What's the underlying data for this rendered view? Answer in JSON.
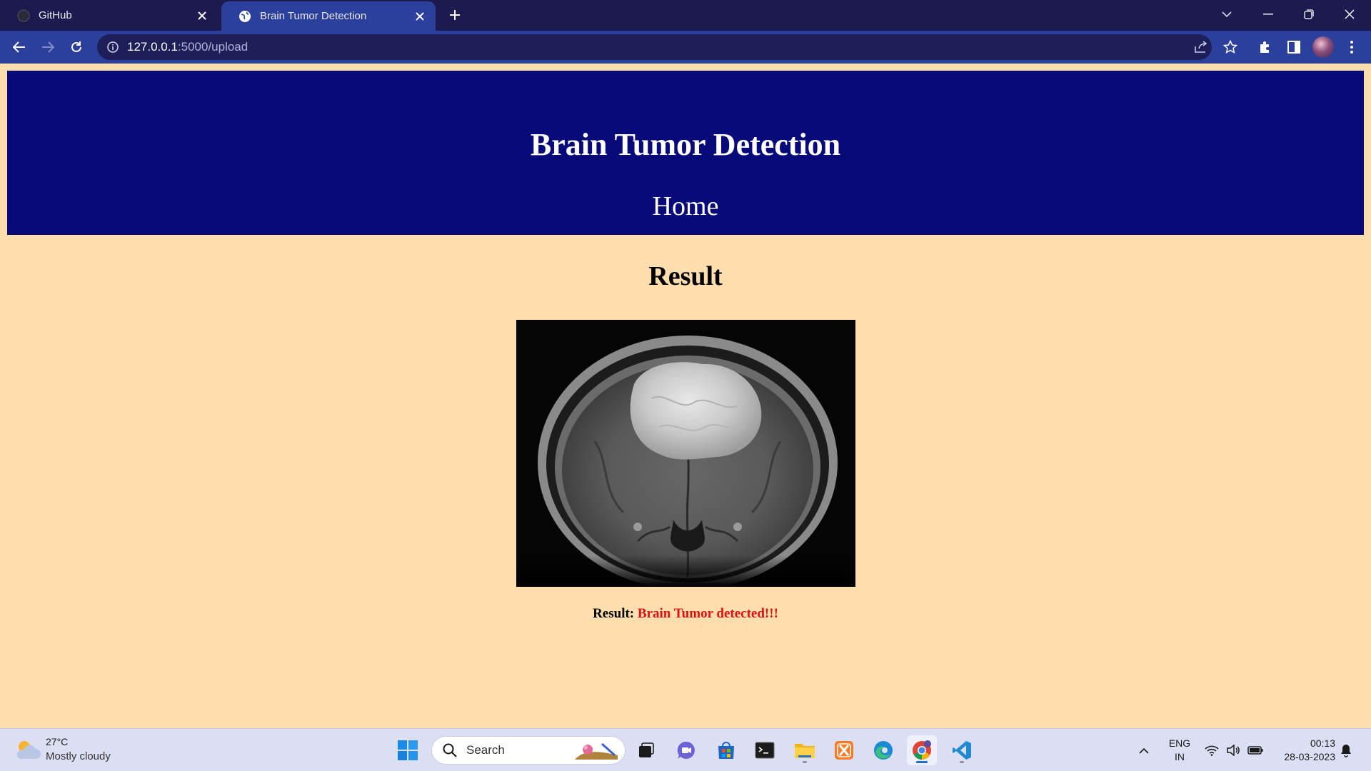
{
  "browser": {
    "tabs": [
      {
        "title": "GitHub",
        "active": false
      },
      {
        "title": "Brain Tumor Detection",
        "active": true
      }
    ],
    "url": {
      "host": "127.0.0.1",
      "path": ":5000/upload"
    }
  },
  "page": {
    "site_title": "Brain Tumor Detection",
    "nav_home": "Home",
    "result_heading": "Result",
    "result_label": "Result:",
    "result_value": "Brain Tumor detected!!!",
    "image_alt": "MRI brain scan",
    "colors": {
      "background": "#ffdead",
      "banner": "#070a78",
      "result_value": "#e01010"
    }
  },
  "taskbar": {
    "weather": {
      "temp": "27°C",
      "desc": "Mostly cloudy"
    },
    "search_placeholder": "Search",
    "apps": [
      "windows-start",
      "task-view",
      "teams-chat",
      "microsoft-store",
      "terminal",
      "file-explorer",
      "xampp",
      "edge",
      "chrome",
      "vscode"
    ],
    "language": {
      "line1": "ENG",
      "line2": "IN"
    },
    "clock": {
      "time": "00:13",
      "date": "28-03-2023"
    }
  }
}
